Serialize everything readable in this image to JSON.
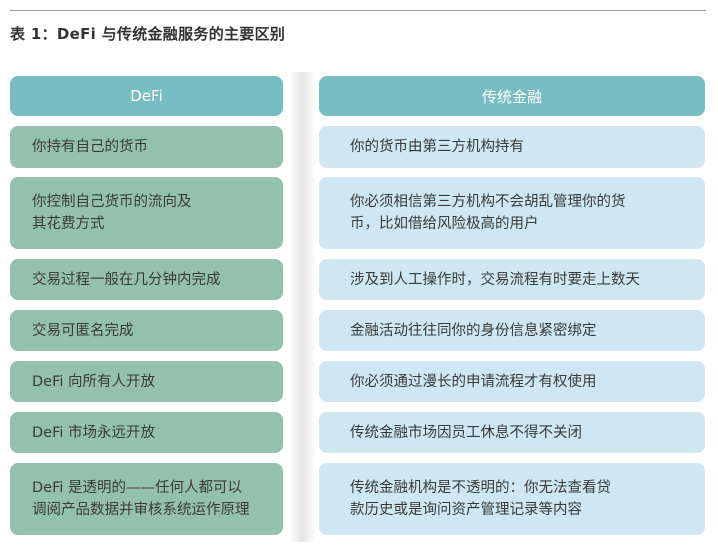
{
  "title": "表 1：DeFi 与传统金融服务的主要区别",
  "headers": {
    "left": "DeFi",
    "right": "传统金融"
  },
  "rows": [
    {
      "left": "你持有自己的货币",
      "right": "你的货币由第三方机构持有"
    },
    {
      "left": "你控制自己货币的流向及\n其花费方式",
      "right": "你必须相信第三方机构不会胡乱管理你的货\n币，比如借给风险极高的用户"
    },
    {
      "left": "交易过程一般在几分钟内完成",
      "right": "涉及到人工操作时，交易流程有时要走上数天"
    },
    {
      "left": "交易可匿名完成",
      "right": "金融活动往往同你的身份信息紧密绑定"
    },
    {
      "left": "DeFi 向所有人开放",
      "right": "你必须通过漫长的申请流程才有权使用"
    },
    {
      "left": "DeFi 市场永远开放",
      "right": "传统金融市场因员工休息不得不关闭"
    },
    {
      "left": "DeFi 是透明的——任何人都可以\n调阅产品数据并审核系统运作原理",
      "right": "传统金融机构是不透明的：你无法查看贷\n款历史或是询问资产管理记录等内容"
    }
  ],
  "colors": {
    "header": "#78bcc4",
    "left_cell": "#93c1ae",
    "right_cell": "#cfe7f3"
  }
}
